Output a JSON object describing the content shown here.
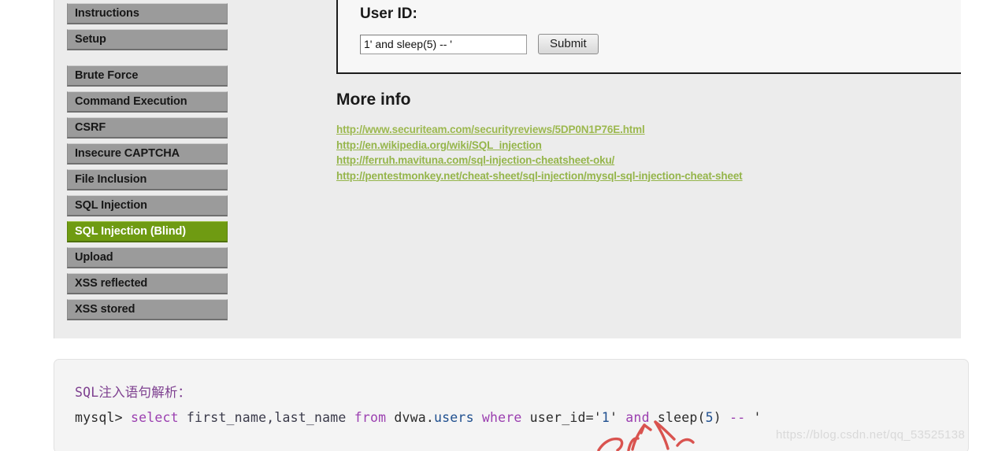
{
  "app": {
    "name": "DVWA",
    "active_section": "SQL Injection (Blind)"
  },
  "colors": {
    "sidebar_item_bg": "#9b9b9b",
    "sidebar_active_bg": "#6f9b12",
    "sidebar_active_text": "#ffffff",
    "page_bg": "#ececec",
    "link_green": "#95b54b",
    "note_heading_purple": "#7d3f8f",
    "sql_keyword_purple": "#9b3fb0",
    "annotation_red": "#d9534f",
    "watermark_gray": "#d9d9d9"
  },
  "sidebar": {
    "groups": [
      {
        "items": [
          {
            "label": "",
            "clipped": true,
            "active": false
          },
          {
            "label": "Instructions",
            "clipped": false,
            "active": false
          },
          {
            "label": "Setup",
            "clipped": false,
            "active": false
          }
        ]
      },
      {
        "items": [
          {
            "label": "Brute Force",
            "clipped": false,
            "active": false
          },
          {
            "label": "Command Execution",
            "clipped": false,
            "active": false
          },
          {
            "label": "CSRF",
            "clipped": false,
            "active": false
          },
          {
            "label": "Insecure CAPTCHA",
            "clipped": false,
            "active": false
          },
          {
            "label": "File Inclusion",
            "clipped": false,
            "active": false
          },
          {
            "label": "SQL Injection",
            "clipped": false,
            "active": false
          },
          {
            "label": "SQL Injection (Blind)",
            "clipped": false,
            "active": true
          },
          {
            "label": "Upload",
            "clipped": false,
            "active": false
          },
          {
            "label": "XSS reflected",
            "clipped": false,
            "active": false
          },
          {
            "label": "XSS stored",
            "clipped": false,
            "active": false
          }
        ]
      }
    ]
  },
  "vulnerability_box": {
    "title": "User ID:",
    "input_value": "1' and sleep(5) -- '",
    "input_placeholder": "",
    "submit_label": "Submit"
  },
  "more_info": {
    "title": "More info",
    "links": [
      "http://www.securiteam.com/securityreviews/5DP0N1P76E.html",
      "http://en.wikipedia.org/wiki/SQL_injection",
      "http://ferruh.mavituna.com/sql-injection-cheatsheet-oku/",
      "http://pentestmonkey.net/cheat-sheet/sql-injection/mysql-sql-injection-cheat-sheet"
    ]
  },
  "note_panel": {
    "heading": "SQL注入语句解析：",
    "sql_full": "mysql> select first_name,last_name from dvwa.users where user_id='1' and sleep(5) -- '",
    "sql_tokens": [
      {
        "text": "mysql> ",
        "kind": "prompt"
      },
      {
        "text": "select ",
        "kind": "kw"
      },
      {
        "text": "first_name,last_name ",
        "kind": "id"
      },
      {
        "text": "from ",
        "kind": "kw"
      },
      {
        "text": "dvwa.",
        "kind": "plain"
      },
      {
        "text": "users ",
        "kind": "tbl"
      },
      {
        "text": "where ",
        "kind": "kw"
      },
      {
        "text": "user_id=",
        "kind": "plain"
      },
      {
        "text": "'",
        "kind": "str"
      },
      {
        "text": "1",
        "kind": "num"
      },
      {
        "text": "' ",
        "kind": "str"
      },
      {
        "text": "and ",
        "kind": "kw"
      },
      {
        "text": "sleep",
        "kind": "plain"
      },
      {
        "text": "(",
        "kind": "plain"
      },
      {
        "text": "5",
        "kind": "num"
      },
      {
        "text": ") ",
        "kind": "plain"
      },
      {
        "text": "-- ",
        "kind": "kw"
      },
      {
        "text": "'",
        "kind": "str"
      }
    ]
  },
  "annotation": {
    "type": "hand-drawn-red-arrow",
    "target": "'1'"
  },
  "watermark": {
    "text": "https://blog.csdn.net/qq_53525138"
  }
}
